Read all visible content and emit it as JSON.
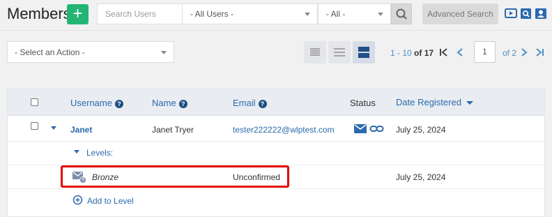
{
  "header": {
    "title": "Members",
    "add_icon": "plus-icon",
    "search_placeholder": "Search Users",
    "users_filter": "- All Users -",
    "all_filter": "- All -",
    "advanced_search_label": "Advanced Search",
    "icons": [
      "video-icon",
      "search-document-icon",
      "user-card-icon"
    ]
  },
  "toolbar": {
    "action_select": "- Select an Action -",
    "view_modes": [
      "compact-view-icon",
      "list-view-icon",
      "expanded-view-icon"
    ],
    "pagination": {
      "range": "1 - 10",
      "of_label": "of",
      "total": "17",
      "current_page": "1",
      "of_pages": "of 2"
    }
  },
  "table": {
    "columns": {
      "username": "Username",
      "name": "Name",
      "email": "Email",
      "status": "Status",
      "date_registered": "Date Registered"
    },
    "row": {
      "username": "Janet",
      "name": "Janet Tryer",
      "email": "tester222222@wlptest.com",
      "date_registered": "July 25, 2024",
      "status_icons": [
        "envelope-icon",
        "link-icon"
      ]
    },
    "levels_label": "Levels:",
    "level": {
      "name": "Bronze",
      "status": "Unconfirmed",
      "date": "July 25, 2024"
    },
    "add_level_label": "Add to Level"
  },
  "colors": {
    "accent_green": "#22b573",
    "link_blue": "#2a6aad",
    "highlight_red": "#e30000"
  }
}
